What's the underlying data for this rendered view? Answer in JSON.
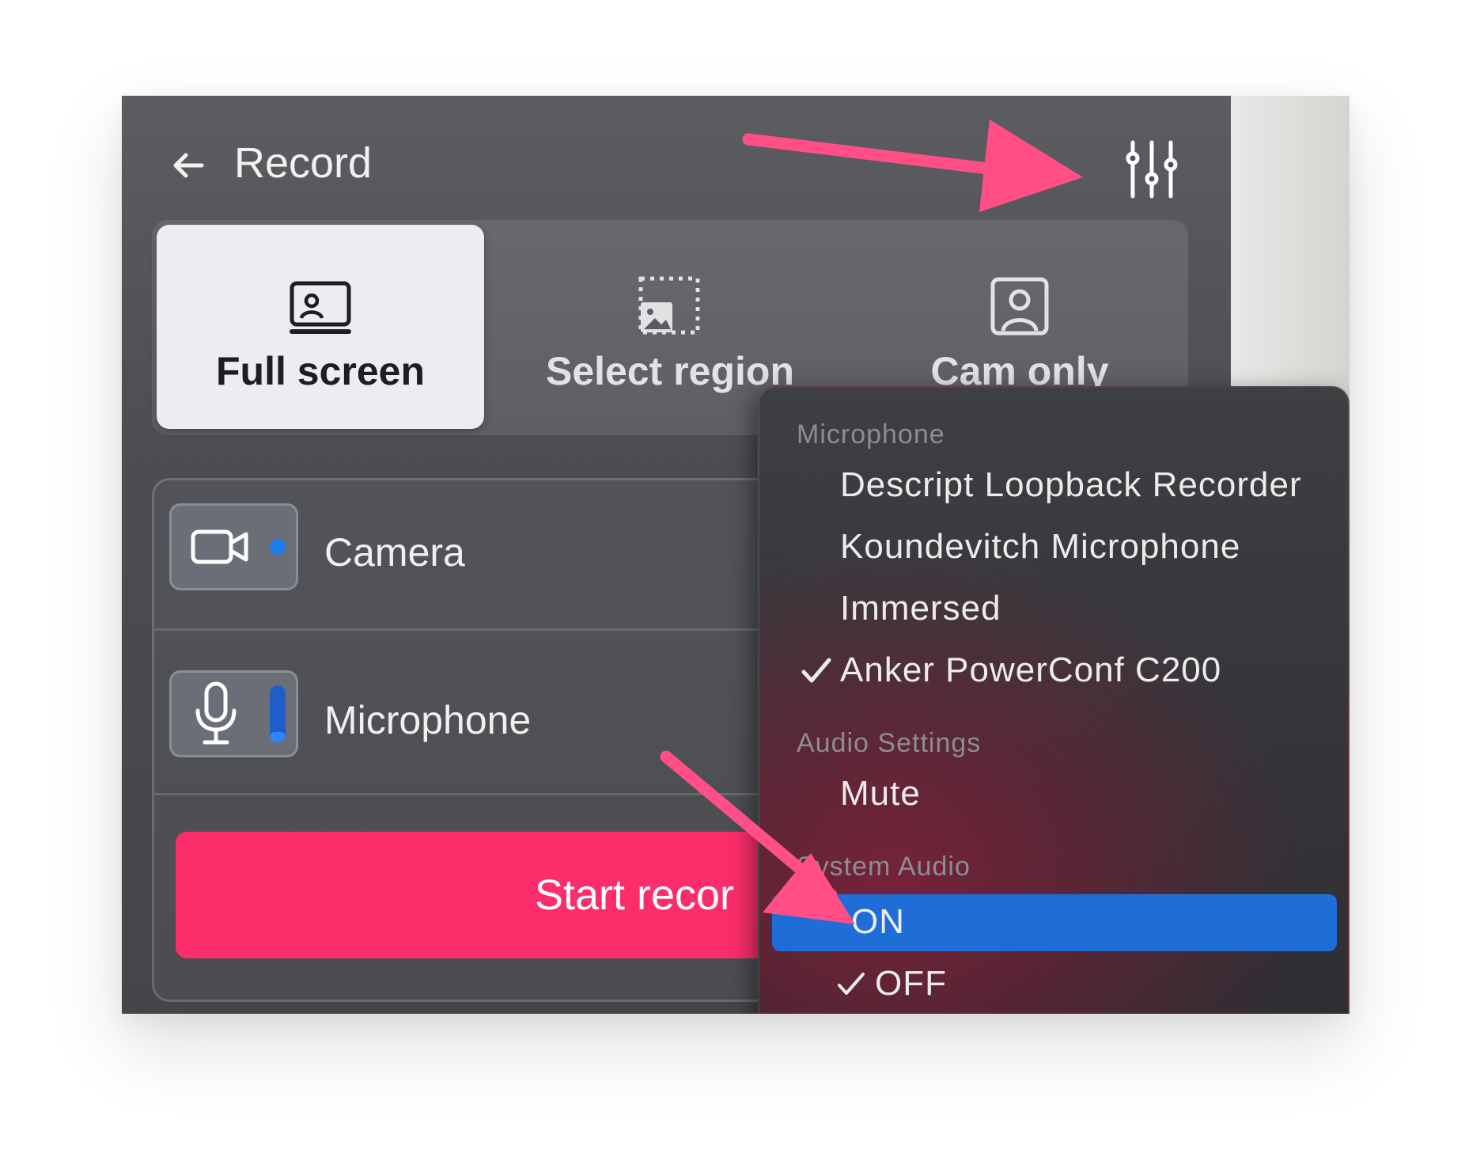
{
  "header": {
    "title": "Record",
    "back_icon": "arrow-left-icon",
    "settings_icon": "sliders-icon"
  },
  "modes": [
    {
      "label": "Full screen",
      "icon": "monitor-person-icon",
      "active": true
    },
    {
      "label": "Select region",
      "icon": "dashed-region-icon",
      "active": false
    },
    {
      "label": "Cam only",
      "icon": "person-square-icon",
      "active": false
    }
  ],
  "sources": {
    "camera": {
      "label": "Camera",
      "icon": "video-camera-icon",
      "indicator_color": "#1e7af0"
    },
    "microphone": {
      "label": "Microphone",
      "icon": "microphone-icon",
      "level": 0.18
    }
  },
  "start_button": {
    "label": "Start recor"
  },
  "menu": {
    "microphone_header": "Microphone",
    "microphone_items": [
      {
        "label": "Descript Loopback Recorder",
        "checked": false
      },
      {
        "label": "Koundevitch Microphone",
        "checked": false
      },
      {
        "label": "Immersed",
        "checked": false
      },
      {
        "label": "Anker PowerConf C200",
        "checked": true
      }
    ],
    "audio_header": "Audio Settings",
    "audio_items": [
      {
        "label": "Mute",
        "checked": false
      }
    ],
    "system_header": "System Audio",
    "system_items": [
      {
        "label": "ON",
        "checked": false,
        "highlighted": true
      },
      {
        "label": "OFF",
        "checked": true,
        "highlighted": false
      }
    ]
  },
  "colors": {
    "accent_pink": "#fb2d6a",
    "highlight_blue": "#1f6ed8",
    "annotation_arrow": "#ff4f86"
  }
}
